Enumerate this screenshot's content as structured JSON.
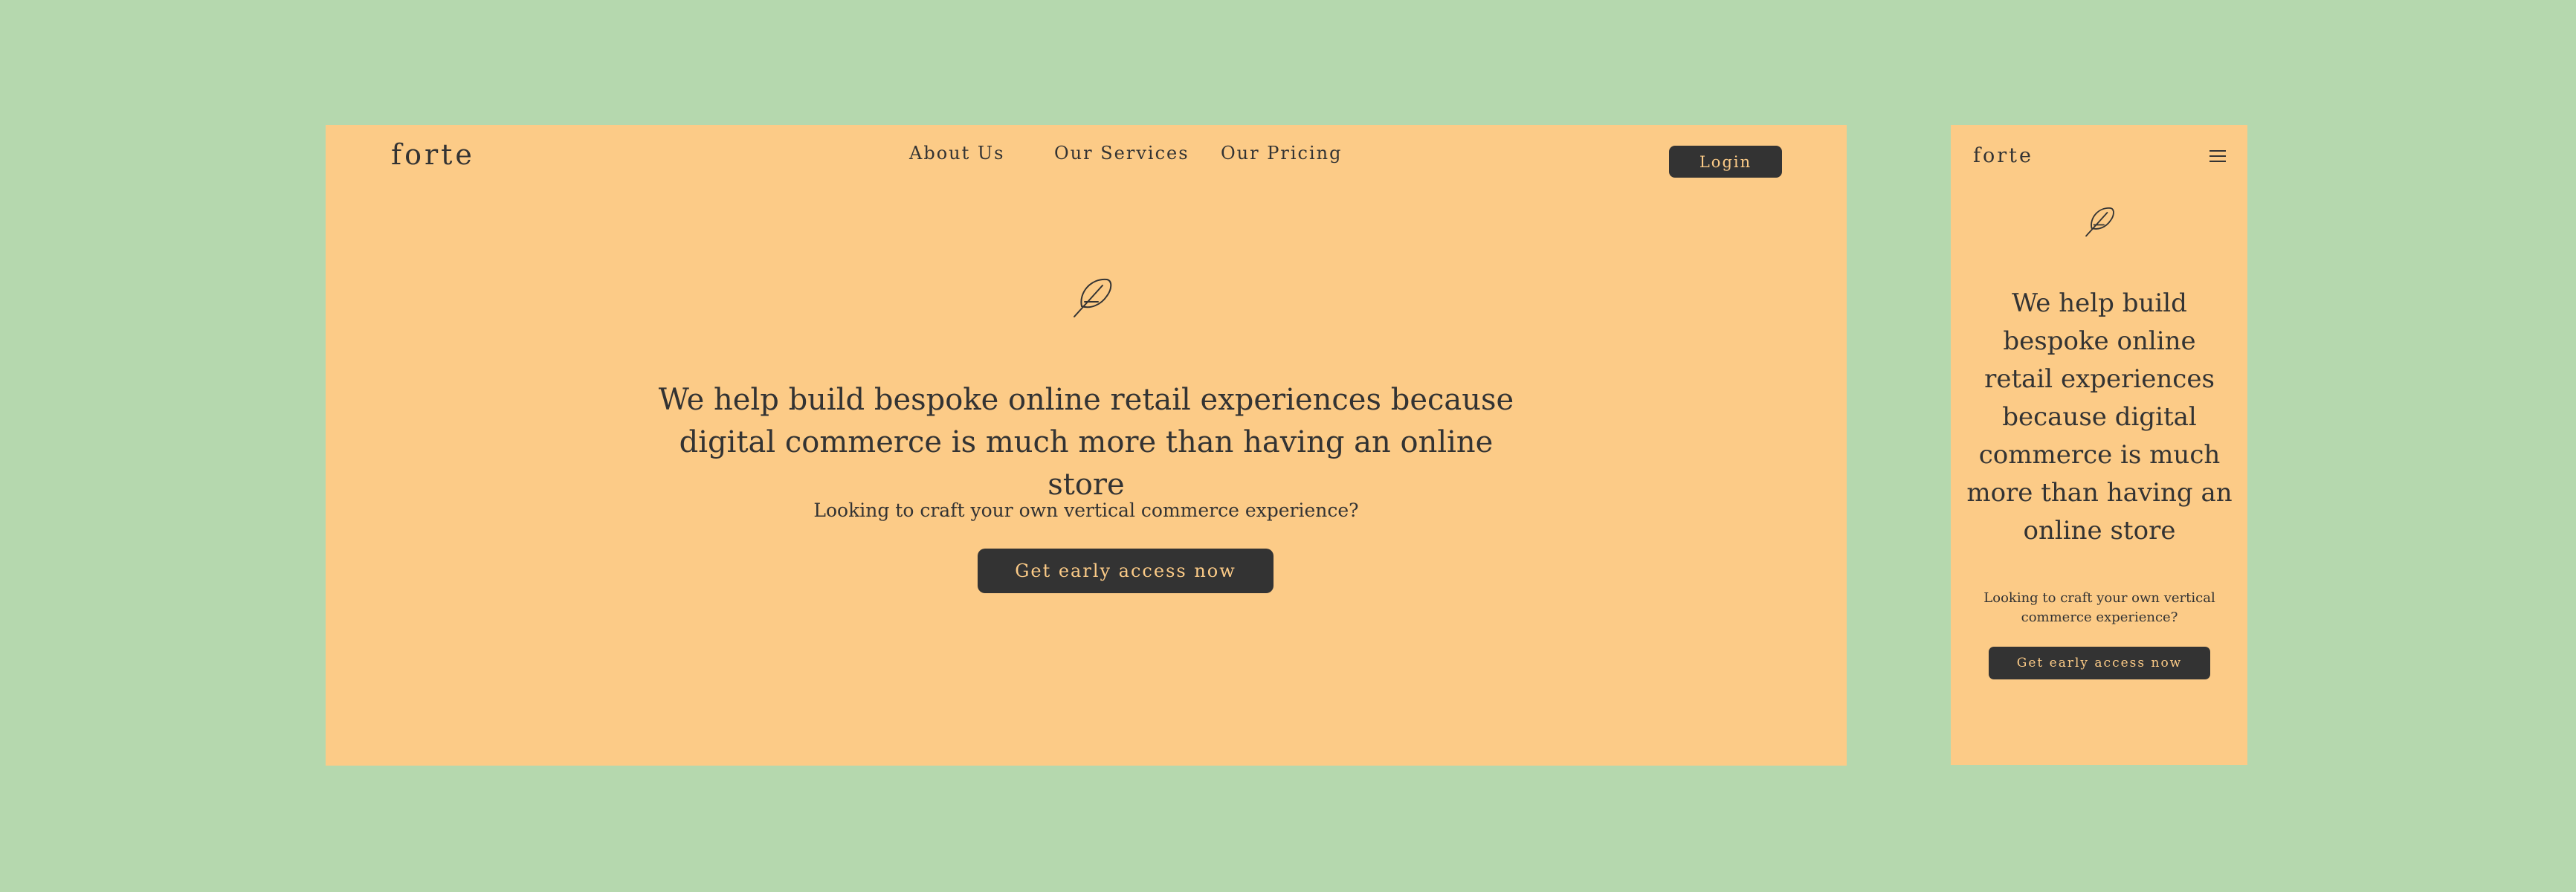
{
  "brand": {
    "logo": "forte"
  },
  "nav": {
    "items": [
      {
        "label": "About Us"
      },
      {
        "label": "Our Services"
      },
      {
        "label": "Our Pricing"
      }
    ],
    "login_label": "Login",
    "menu_icon": "hamburger-icon"
  },
  "hero": {
    "icon": "feather-icon",
    "headline": "We help build bespoke online retail experiences because digital commerce is much more than having an online store",
    "subtext": "Looking to craft your own vertical commerce experience?",
    "cta_label": "Get early access now"
  },
  "colors": {
    "background": "#b5d8ae",
    "panel": "#fccb87",
    "dark": "#333333",
    "button_text": "#fccb87"
  }
}
